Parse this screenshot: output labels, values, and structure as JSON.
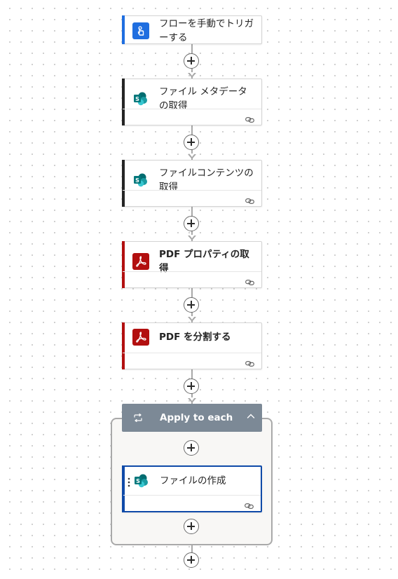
{
  "steps": [
    {
      "title": "フローを手動でトリガーする",
      "icon": "manual-trigger-icon",
      "accent": "#1f6ee0"
    },
    {
      "title": "ファイル メタデータの取得",
      "icon": "sharepoint-icon",
      "accent": "#242424"
    },
    {
      "title": "ファイルコンテンツの取得",
      "icon": "sharepoint-icon",
      "accent": "#242424"
    },
    {
      "title": "PDF プロパティの取得",
      "icon": "adobe-pdf-icon",
      "accent": "#b20f0f"
    },
    {
      "title": "PDF を分割する",
      "icon": "adobe-pdf-icon",
      "accent": "#b20f0f"
    }
  ],
  "loop": {
    "title": "Apply to each",
    "header_color": "#7c8996",
    "inner": {
      "title": "ファイルの作成",
      "icon": "sharepoint-icon",
      "accent": "#0f4aa8"
    }
  },
  "colors": {
    "sharepoint": "#038387",
    "adobe": "#b20f0f",
    "trigger": "#1f6ee0"
  }
}
